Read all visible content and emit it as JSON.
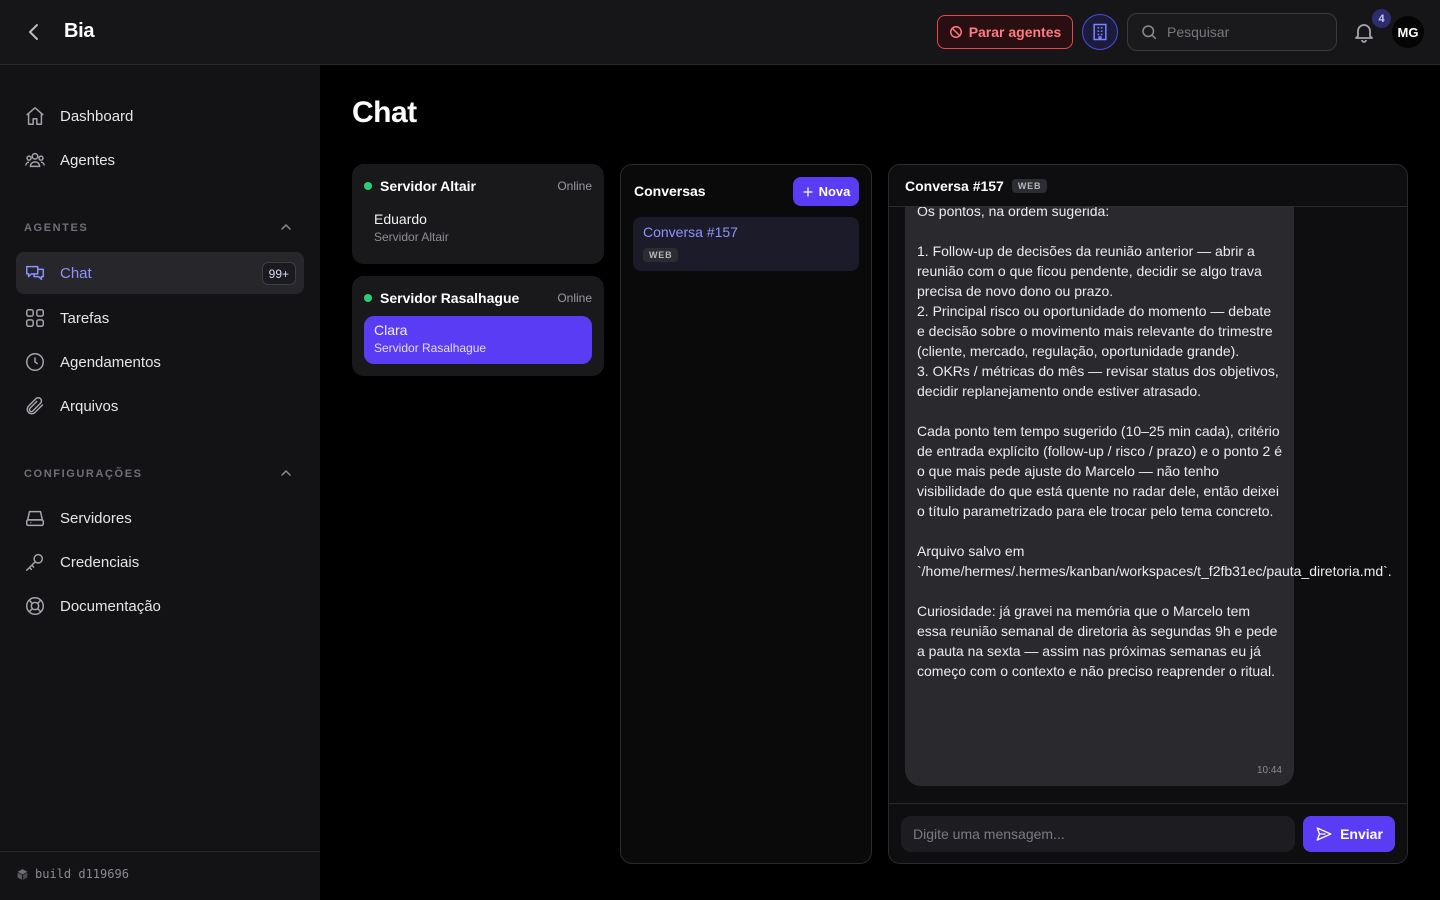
{
  "app": {
    "title": "Bia"
  },
  "topbar": {
    "stop_agents_label": "Parar agentes",
    "search_placeholder": "Pesquisar",
    "notifications_count": "4",
    "avatar_initials": "MG"
  },
  "sidebar": {
    "top_items": [
      {
        "label": "Dashboard",
        "icon": "home-icon"
      },
      {
        "label": "Agentes",
        "icon": "users-icon"
      }
    ],
    "agents_section": {
      "label": "AGENTES",
      "items": [
        {
          "label": "Chat",
          "icon": "chat-icon",
          "badge": "99+",
          "active": true
        },
        {
          "label": "Tarefas",
          "icon": "grid-icon"
        },
        {
          "label": "Agendamentos",
          "icon": "clock-icon"
        },
        {
          "label": "Arquivos",
          "icon": "paperclip-icon"
        }
      ]
    },
    "settings_section": {
      "label": "CONFIGURAÇÕES",
      "items": [
        {
          "label": "Servidores",
          "icon": "server-icon"
        },
        {
          "label": "Credenciais",
          "icon": "key-icon"
        },
        {
          "label": "Documentação",
          "icon": "lifebuoy-icon"
        }
      ]
    },
    "build": "build d119696"
  },
  "main": {
    "title": "Chat",
    "servers": [
      {
        "name": "Servidor Altair",
        "status": "Online",
        "agents": [
          {
            "name": "Eduardo",
            "server": "Servidor Altair",
            "selected": false
          }
        ]
      },
      {
        "name": "Servidor Rasalhague",
        "status": "Online",
        "agents": [
          {
            "name": "Clara",
            "server": "Servidor Rasalhague",
            "selected": true
          }
        ]
      }
    ],
    "conversations": {
      "title": "Conversas",
      "new_label": "Nova",
      "items": [
        {
          "title": "Conversa #157",
          "tag": "WEB"
        }
      ]
    },
    "chat": {
      "title": "Conversa #157",
      "tag": "WEB",
      "message": "Os pontos, na ordem sugerida:\n\n1. Follow-up de decisões da reunião anterior — abrir a reunião com o que ficou pendente, decidir se algo trava precisa de novo dono ou prazo.\n2. Principal risco ou oportunidade do momento — debate e decisão sobre o movimento mais relevante do trimestre (cliente, mercado, regulação, oportunidade grande).\n3. OKRs / métricas do mês — revisar status dos objetivos, decidir replanejamento onde estiver atrasado.\n\nCada ponto tem tempo sugerido (10–25 min cada), critério de entrada explícito (follow-up / risco / prazo) e o ponto 2 é o que mais pede ajuste do Marcelo — não tenho visibilidade do que está quente no radar dele, então deixei o título parametrizado para ele trocar pelo tema concreto.\n\nArquivo salvo em `/home/hermes/.hermes/kanban/workspaces/t_f2fb31ec/pauta_diretoria.md`.\n\nCuriosidade: já gravei na memória que o Marcelo tem essa reunião semanal de diretoria às segundas 9h e pede a pauta na sexta — assim nas próximas semanas eu já começo com o contexto e não preciso reaprender o ritual.",
      "message_time": "10:44",
      "input_placeholder": "Digite uma mensagem...",
      "send_label": "Enviar"
    }
  },
  "colors": {
    "accent": "#5b3cf5",
    "online": "#2ecc71",
    "danger": "#e5484d"
  }
}
